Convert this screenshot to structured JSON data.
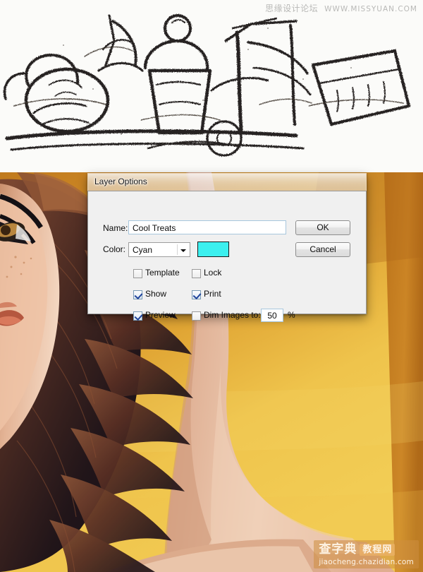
{
  "watermarks": {
    "top_cn": "思缘设计论坛",
    "top_url": "WWW.MISSYUAN.COM",
    "logo_cn": "查字典",
    "logo_cn2": "教程网",
    "logo_url": "jiaocheng.chazidian.com"
  },
  "artwork": {
    "top_panel": "pencil-sketch-of-ice-cream-cart",
    "bottom_panel": "vector-illustration-woman-with-glasses",
    "sketch_bg": "#fbfbf9",
    "sketch_ink": "#2a2622",
    "gold_light": "#f0c350",
    "gold_mid": "#d08b2a",
    "gold_dark": "#a65f16",
    "skin_light": "#efccb4",
    "skin_mid": "#dda688",
    "hair_dark": "#1e1418",
    "hair_mid": "#6b3b2c"
  },
  "dialog": {
    "title": "Layer Options",
    "name": {
      "label": "Name:",
      "value": "Cool Treats"
    },
    "color": {
      "label": "Color:",
      "selected": "Cyan",
      "swatch_hex": "#3cf0ef",
      "options": [
        "Cyan"
      ]
    },
    "buttons": {
      "ok": "OK",
      "cancel": "Cancel"
    },
    "checkboxes": [
      {
        "key": "template",
        "label": "Template",
        "checked": false
      },
      {
        "key": "lock",
        "label": "Lock",
        "checked": false
      },
      {
        "key": "show",
        "label": "Show",
        "checked": true
      },
      {
        "key": "print",
        "label": "Print",
        "checked": true
      },
      {
        "key": "preview",
        "label": "Preview",
        "checked": true
      },
      {
        "key": "dim",
        "label": "Dim Images to:",
        "checked": false
      }
    ],
    "dim": {
      "value": "50",
      "unit": "%"
    }
  }
}
